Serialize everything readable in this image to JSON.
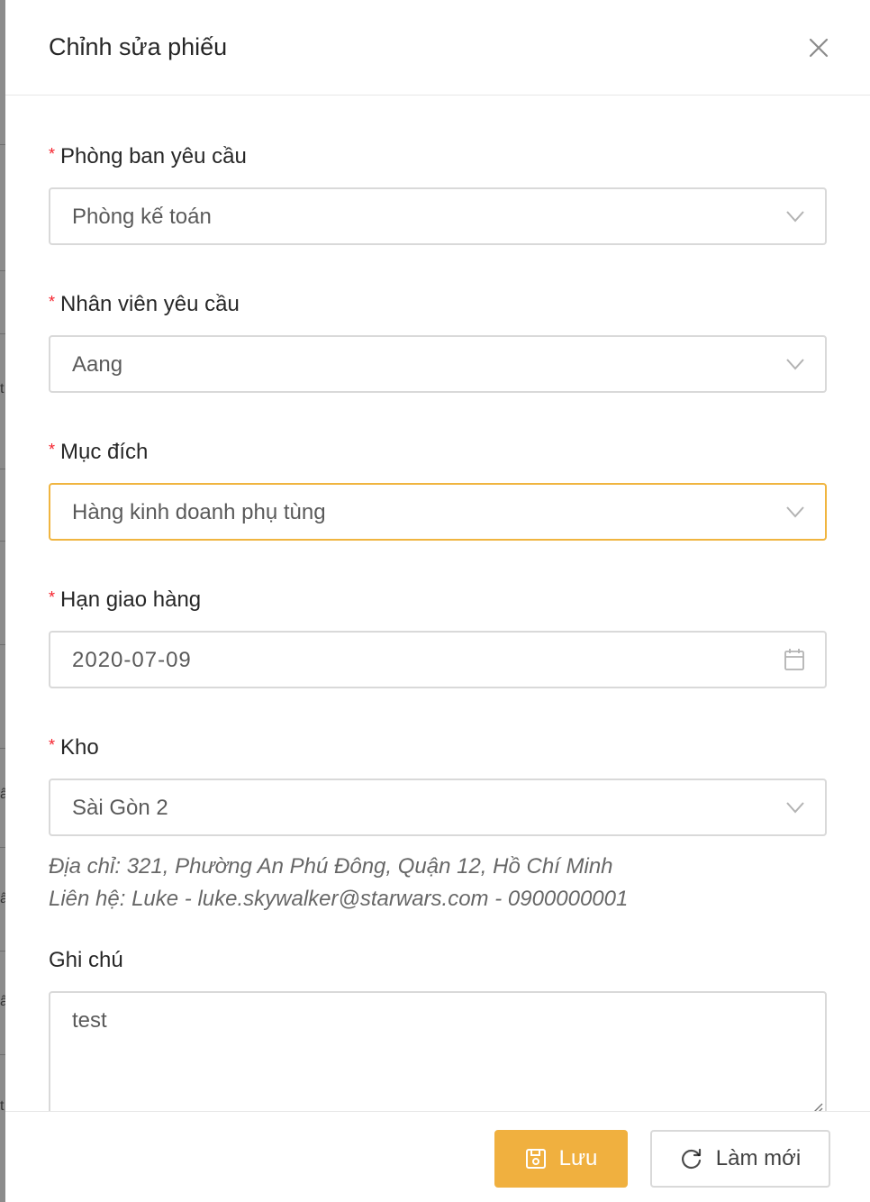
{
  "drawer": {
    "title": "Chỉnh sửa phiếu"
  },
  "form": {
    "department": {
      "label": "Phòng ban yêu cầu",
      "value": "Phòng kế toán",
      "required": true
    },
    "employee": {
      "label": "Nhân viên yêu cầu",
      "value": "Aang",
      "required": true
    },
    "purpose": {
      "label": "Mục đích",
      "value": "Hàng kinh doanh phụ tùng",
      "required": true
    },
    "deadline": {
      "label": "Hạn giao hàng",
      "value": "2020-07-09",
      "required": true
    },
    "warehouse": {
      "label": "Kho",
      "value": "Sài Gòn 2",
      "required": true,
      "address": "Địa chỉ: 321, Phường An Phú Đông, Quận 12, Hồ Chí Minh",
      "contact": "Liên hệ: Luke - luke.skywalker@starwars.com - 0900000001"
    },
    "note": {
      "label": "Ghi chú",
      "value": "test"
    }
  },
  "footer": {
    "save_label": "Lưu",
    "reset_label": "Làm mới"
  },
  "colors": {
    "primary": "#f0b03f",
    "required": "#f5222d",
    "focus_border": "#f0b540"
  },
  "icons": [
    "close-icon",
    "chevron-down-icon",
    "calendar-icon",
    "save-icon",
    "reload-icon"
  ]
}
